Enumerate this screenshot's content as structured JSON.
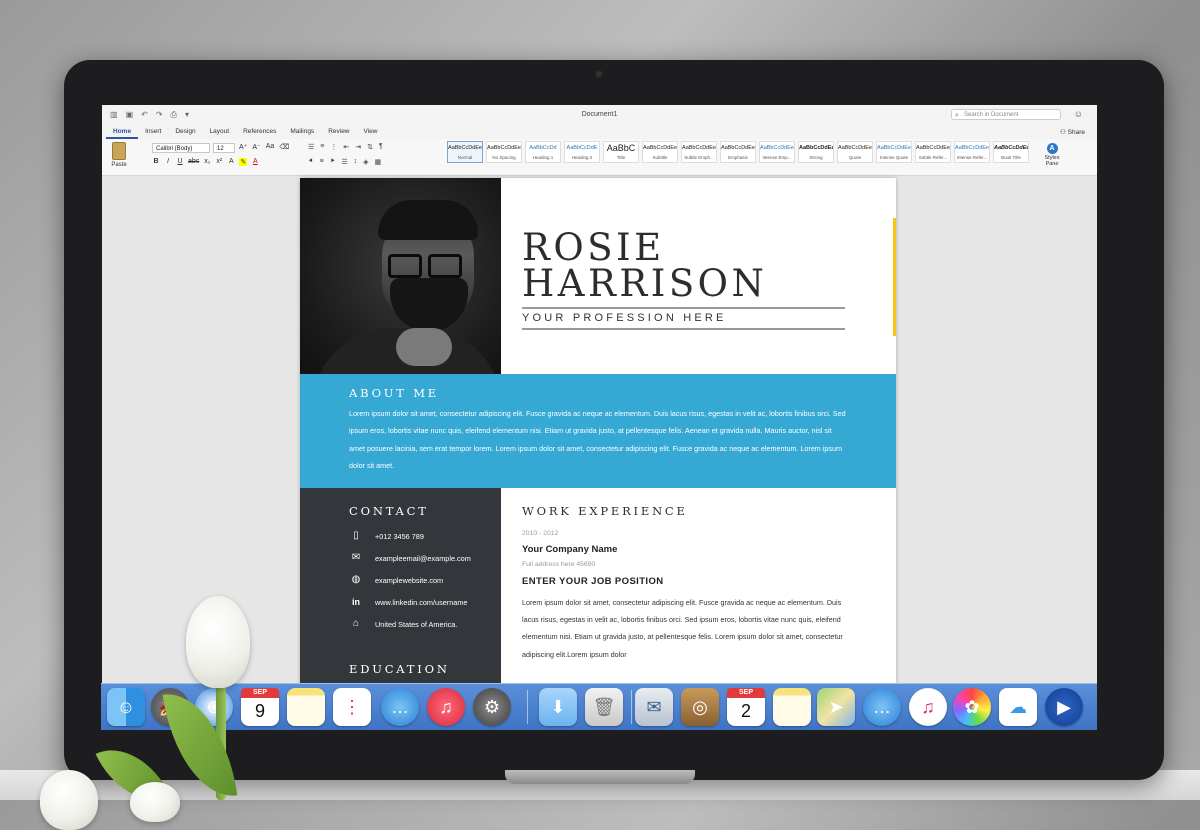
{
  "window": {
    "doc_title": "Document1",
    "search_placeholder": "Search in Document",
    "share_label": "Share"
  },
  "tabs": [
    "Home",
    "Insert",
    "Design",
    "Layout",
    "References",
    "Mailings",
    "Review",
    "View"
  ],
  "ribbon": {
    "paste_label": "Paste",
    "font_family": "Calibri (Body)",
    "font_size": "12",
    "styles_pane_label": "Styles Pane",
    "styles": [
      {
        "sample": "AaBbCcDdEe",
        "name": "Normal"
      },
      {
        "sample": "AaBbCcDdEe",
        "name": "No Spacing"
      },
      {
        "sample": "AaBbCcDd",
        "name": "Heading 1"
      },
      {
        "sample": "AaBbCcDdE",
        "name": "Heading 2"
      },
      {
        "sample": "AaBbC",
        "name": "Title"
      },
      {
        "sample": "AaBbCcDdEe",
        "name": "Subtitle"
      },
      {
        "sample": "AaBbCcDdEe",
        "name": "Subtle Emph..."
      },
      {
        "sample": "AaBbCcDdEe",
        "name": "Emphasis"
      },
      {
        "sample": "AaBbCcDdEe",
        "name": "Intense Emp..."
      },
      {
        "sample": "AaBbCcDdEe",
        "name": "Strong"
      },
      {
        "sample": "AaBbCcDdEe",
        "name": "Quote"
      },
      {
        "sample": "AaBbCcDdEe",
        "name": "Intense Quote"
      },
      {
        "sample": "AaBbCcDdEe",
        "name": "Subtle Refer..."
      },
      {
        "sample": "AaBbCcDdEe",
        "name": "Intense Refer..."
      },
      {
        "sample": "AaBbCcDdEe",
        "name": "Book Title"
      }
    ]
  },
  "resume": {
    "first_name": "ROSIE",
    "last_name": "HARRISON",
    "profession": "YOUR PROFESSION HERE",
    "about_title": "ABOUT ME",
    "about_text": "Lorem ipsum dolor sit amet, consectetur adipiscing elit. Fusce gravida ac neque ac elementum. Duis lacus risus, egestas in velit ac, lobortis finibus orci. Sed ipsum eros, lobortis vitae nunc quis, eleifend elementum nisi. Etiam ut gravida justo, at pellentesque felis. Aenean et gravida nulla. Mauris auctor, nisl sit amet posuere lacinia, sem erat tempor lorem. Lorem ipsum dolor sit amet, consectetur adipiscing elit. Fusce gravida ac neque ac elementum. Lorem ipsum dolor sit amet.",
    "contact_title": "CONTACT",
    "contacts": [
      {
        "icon": "phone-icon",
        "text": "+012 3456 789"
      },
      {
        "icon": "email-icon",
        "text": "exampleemail@example.com"
      },
      {
        "icon": "globe-icon",
        "text": "examplewebsite.com"
      },
      {
        "icon": "linkedin-icon",
        "text": "www.linkedin.com/username"
      },
      {
        "icon": "home-icon",
        "text": "United States of America."
      }
    ],
    "education_title": "EDUCATION",
    "work_title": "WORK EXPERIENCE",
    "work": {
      "date": "2010 - 2012",
      "company": "Your Company Name",
      "address": "Full address here 45690",
      "position": "ENTER YOUR JOB POSITION",
      "text": "Lorem ipsum dolor sit amet, consectetur adipiscing elit. Fusce gravida ac neque ac elementum. Duis lacus risus, egestas in velit ac, lobortis finibus orci. Sed ipsum eros, lobortis vitae nunc quis, eleifend elementum nisi. Etiam ut gravida justo, at pellentesque felis. Lorem ipsum dolor sit amet, consectetur adipiscing elit.Lorem ipsum dolor"
    }
  },
  "dock": {
    "calendar_month": "SEP",
    "calendar_day": "9",
    "calendar_day_2": "2"
  },
  "colors": {
    "accent_blue": "#35a9d4",
    "sidebar_dark": "#33363b",
    "accent_yellow": "#f5c518"
  }
}
